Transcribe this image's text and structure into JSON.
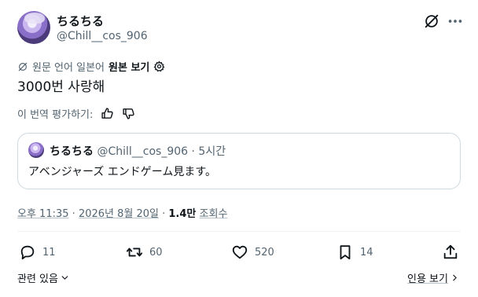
{
  "author": {
    "name": "ちるちる",
    "handle": "@Chill__cos_906"
  },
  "translation": {
    "source_label": "원문 언어 일본어",
    "show_original": "원본 보기"
  },
  "tweet": {
    "text": "3000번 사랑해"
  },
  "rating": {
    "prompt": "이 번역 평가하기:"
  },
  "quote": {
    "name": "ちるちる",
    "handle": "@Chill__cos_906",
    "sep": "·",
    "time": "5시간",
    "text": "アベンジャーズ エンドゲーム見ます。"
  },
  "meta": {
    "time": "오후 11:35",
    "sep1": " · ",
    "date": "2026년 8월 20일",
    "sep2": " · ",
    "views_count": "1.4만",
    "views_label": "조회수"
  },
  "actions": {
    "reply_count": "11",
    "retweet_count": "60",
    "like_count": "520",
    "bookmark_count": "14"
  },
  "footer": {
    "related": "관련 있음",
    "quote_view": "인용 보기"
  },
  "icons": [
    "translate-off-icon",
    "more-icon",
    "translate-icon",
    "gear-icon",
    "thumbs-up-icon",
    "thumbs-down-icon",
    "reply-icon",
    "retweet-icon",
    "like-icon",
    "bookmark-icon",
    "share-icon",
    "chevron-down-icon",
    "chevron-right-icon"
  ]
}
